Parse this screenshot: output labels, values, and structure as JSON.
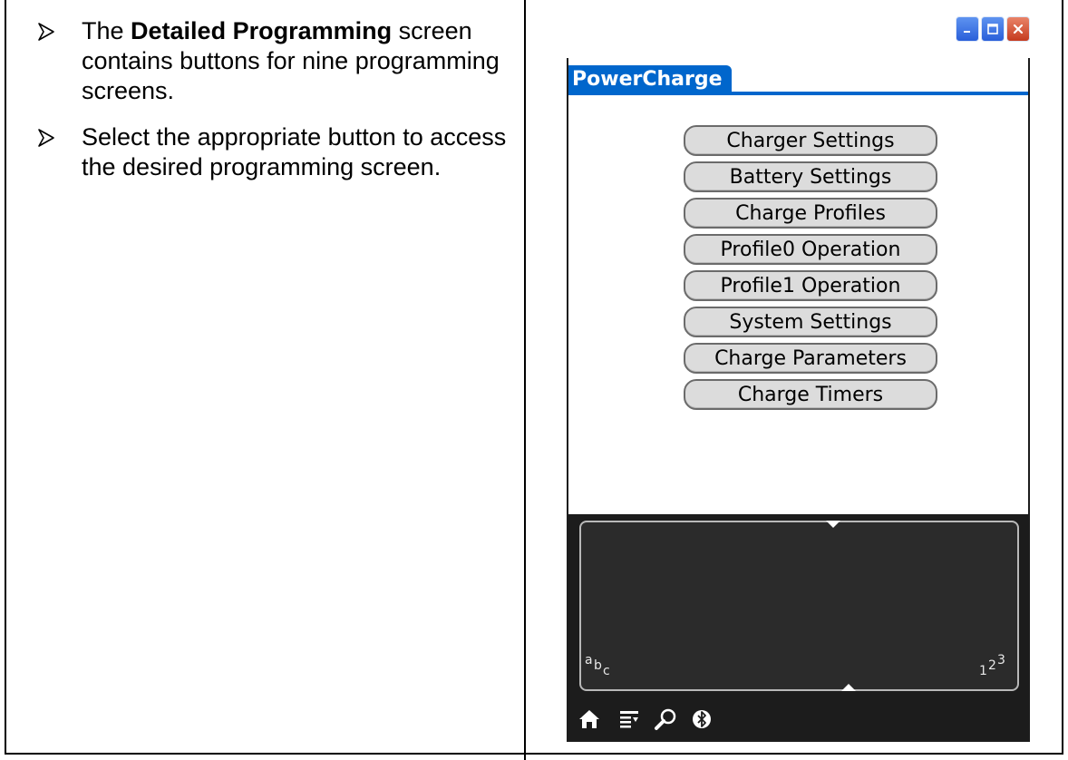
{
  "bullets": [
    {
      "pre": "The ",
      "bold": "Detailed Programming",
      "post": " screen contains buttons for nine programming screens."
    },
    {
      "pre": "Select the appropriate button to access the desired programming screen.",
      "bold": "",
      "post": ""
    }
  ],
  "device": {
    "app_title": "PowerCharge",
    "buttons": [
      "Charger Settings",
      "Battery Settings",
      "Charge Profiles",
      "Profile0 Operation",
      "Profile1 Operation",
      "System Settings",
      "Charge Parameters",
      "Charge Timers"
    ],
    "graffiti": {
      "left_chars": [
        "a",
        "b",
        "c"
      ],
      "right_chars": [
        "1",
        "2",
        "3"
      ]
    },
    "status_icons": [
      "home-icon",
      "menu-icon",
      "find-icon",
      "bluetooth-icon"
    ]
  },
  "colors": {
    "tab_blue": "#0066cc",
    "button_fill": "#dcdcdc",
    "graffiti_bg": "#2b2b2b"
  }
}
